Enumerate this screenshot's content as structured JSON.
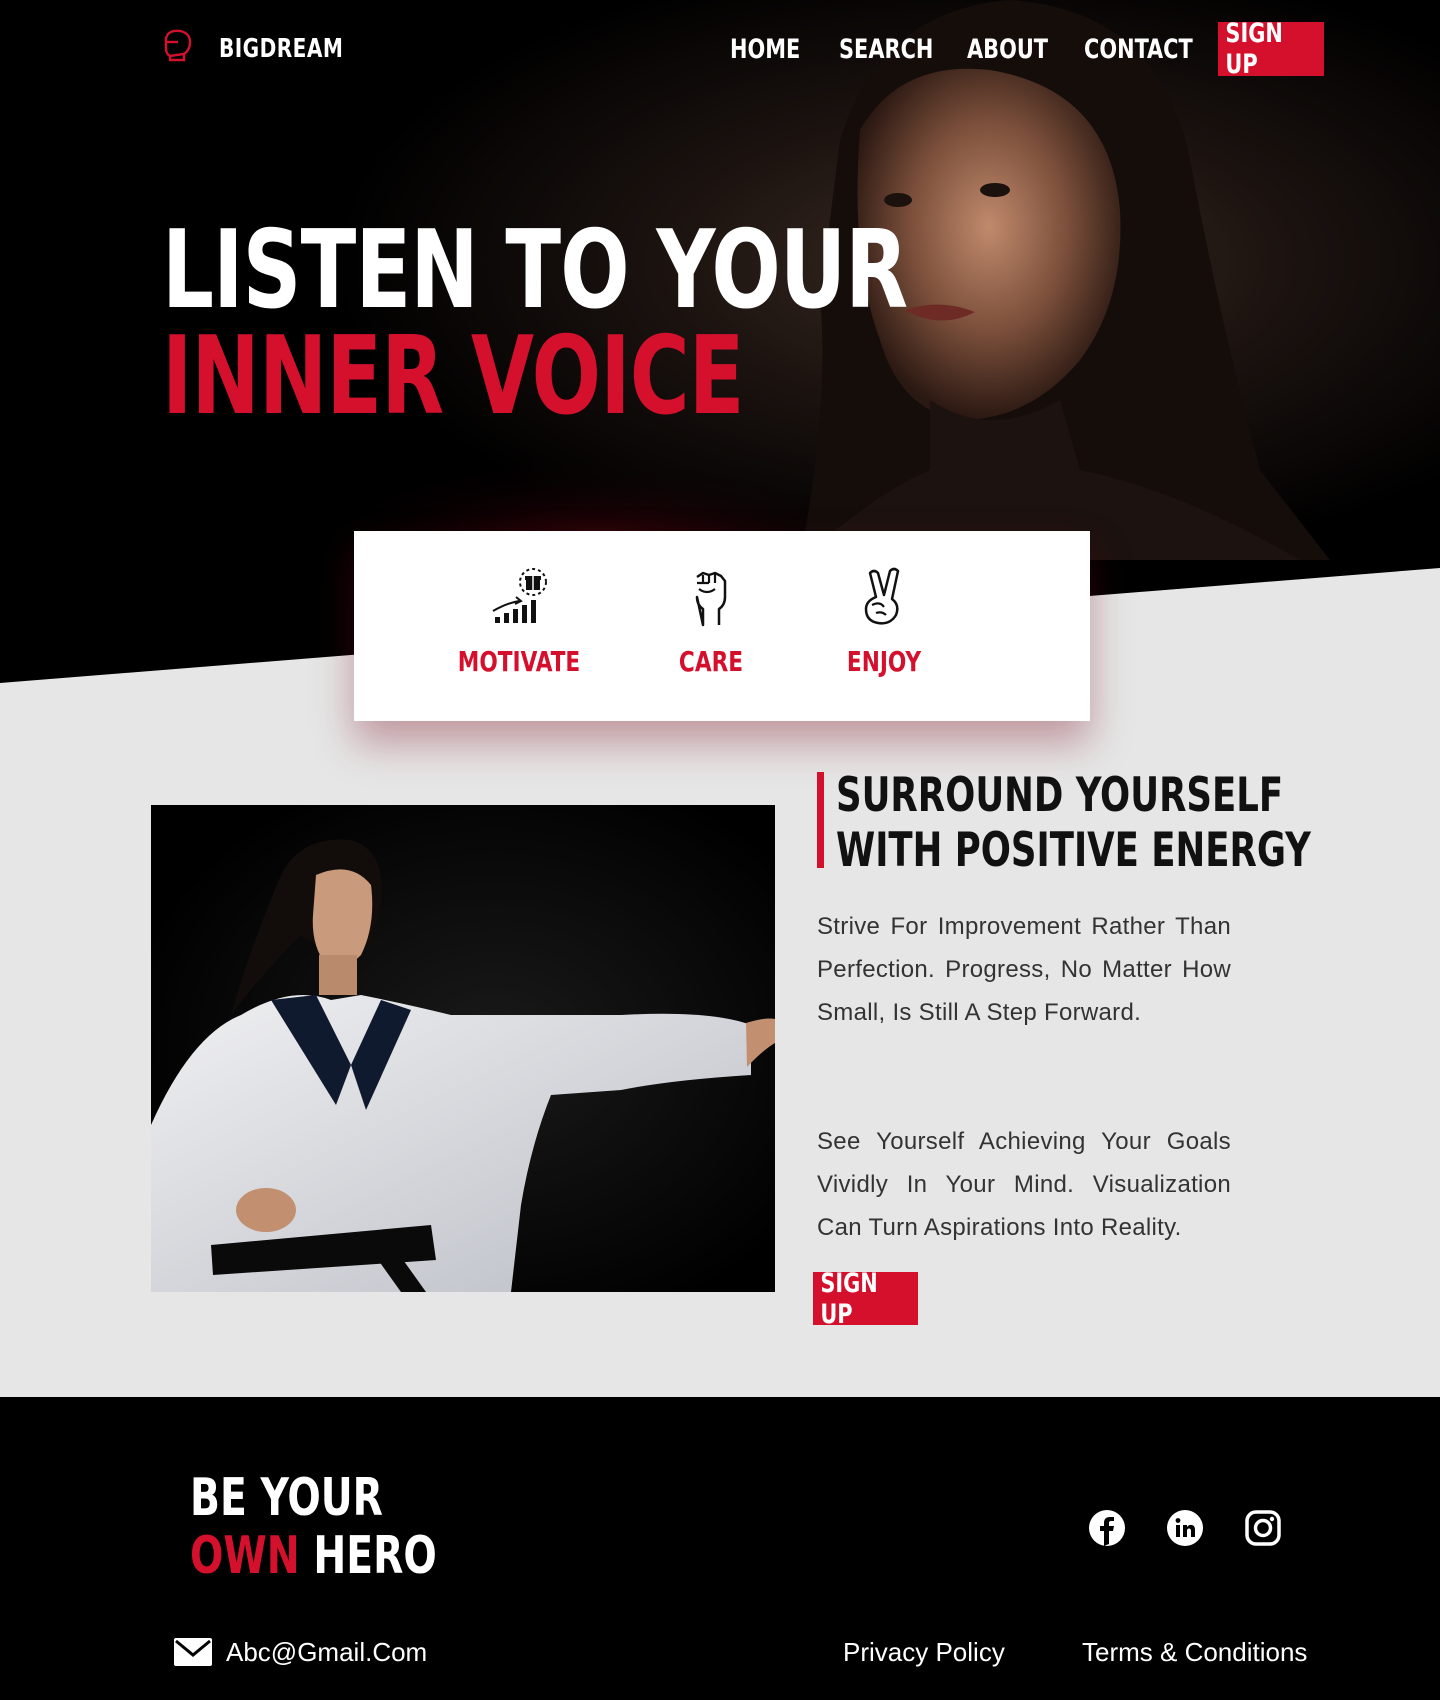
{
  "brand": {
    "name": "BIGDREAM",
    "logo_icon": "boxing-glove-icon"
  },
  "nav": {
    "items": [
      {
        "label": "HOME"
      },
      {
        "label": "SEARCH"
      },
      {
        "label": "ABOUT"
      },
      {
        "label": "CONTACT"
      }
    ],
    "signup_label": "SIGN UP"
  },
  "hero": {
    "headline_line1": "LISTEN TO YOUR",
    "headline_line2": "INNER VOICE",
    "image": "woman-portrait"
  },
  "features": [
    {
      "label": "MOTIVATE",
      "icon": "growth-chart-gift-icon"
    },
    {
      "label": "CARE",
      "icon": "raised-fist-icon"
    },
    {
      "label": "ENJOY",
      "icon": "peace-hand-icon"
    }
  ],
  "section": {
    "title_line1": "SURROUND YOURSELF",
    "title_line2": "WITH POSITIVE ENERGY",
    "paragraph1": "Strive For Improvement Rather Than Perfection. Progress, No Matter How Small, Is Still A Step Forward.",
    "paragraph2": "See Yourself Achieving Your Goals Vividly In Your Mind. Visualization Can Turn Aspirations Into Reality.",
    "signup_label": "SIGN UP",
    "image": "karate-woman-photo"
  },
  "footer": {
    "tagline_line1": "BE YOUR",
    "tagline_own": "OWN",
    "tagline_hero": "HERO",
    "email": "Abc@Gmail.Com",
    "privacy": "Privacy Policy",
    "terms": "Terms & Conditions",
    "social": [
      "facebook-icon",
      "linkedin-icon",
      "instagram-icon"
    ]
  },
  "colors": {
    "accent": "#d5102d",
    "dark": "#000000",
    "light": "#e6e6e6"
  }
}
